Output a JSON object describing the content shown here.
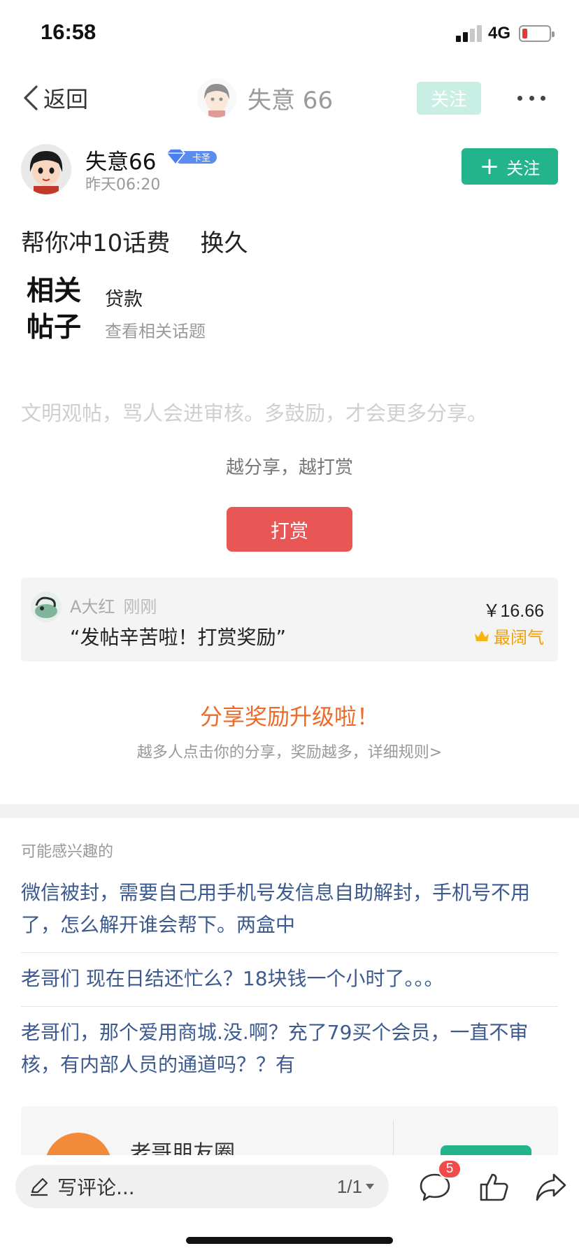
{
  "status_bar": {
    "time": "16:58",
    "network": "4G"
  },
  "nav": {
    "back_label": "返回",
    "title": "失意 66",
    "follow_label": "关注",
    "more_icon": "more-dots-icon"
  },
  "author": {
    "name": "失意66",
    "badge_text": "卡圣",
    "time": "昨天06:20",
    "follow_plus": "+",
    "follow_label": "关注"
  },
  "post": {
    "title": "帮你冲10话费    换久"
  },
  "related": {
    "label": "相关帖子",
    "topic": "贷款",
    "link": "查看相关话题"
  },
  "notice": "文明观帖，骂人会进审核。多鼓励，才会更多分享。",
  "reward": {
    "hint": "越分享，越打赏",
    "button": "打赏"
  },
  "reward_record": {
    "user": "A大红",
    "time": "刚刚",
    "message": "“发帖辛苦啦！打赏奖励”",
    "amount": "￥16.66",
    "top_label": "最阔气"
  },
  "share": {
    "title": "分享奖励升级啦！",
    "subtitle": "越多人点击你的分享，奖励越多，详细规则>"
  },
  "recommend": {
    "label": "可能感兴趣的",
    "items": [
      "微信被封，需要自己用手机号发信息自助解封，手机号不用了，怎么解开谁会帮下。两盒中",
      "老哥们 现在日结还忙么？18块钱一个小时了。。。",
      "老哥们，那个爱用商城.没.啊？充了79买个会员，一直不审核，有内部人员的通道吗？？有"
    ]
  },
  "ad": {
    "name": "老哥朋友圈"
  },
  "bottom": {
    "placeholder": "写评论...",
    "page": "1/1",
    "comment_count": "5"
  },
  "colors": {
    "accent": "#23b48c",
    "reward": "#e85656",
    "link": "#3c5a8e",
    "share": "#ee6a28"
  }
}
